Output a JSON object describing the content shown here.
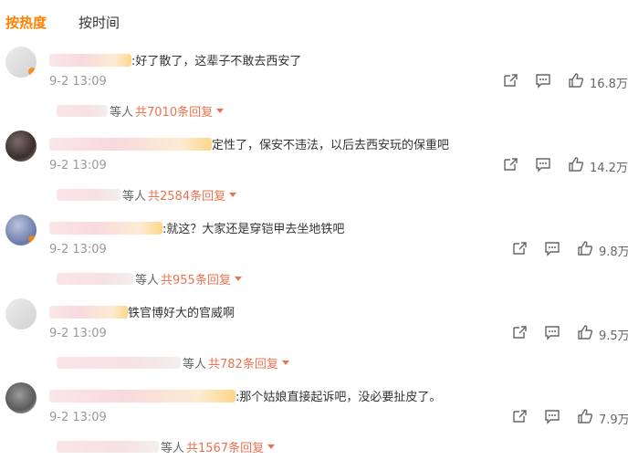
{
  "tabs": [
    {
      "label": "按热度",
      "active": true
    },
    {
      "label": "按时间",
      "active": false
    }
  ],
  "colors": {
    "accent": "#ff8200",
    "reply_link": "#eb7350",
    "muted": "#999999"
  },
  "comments": [
    {
      "text": ":好了散了，这辈子不敢去西安了",
      "time": "9-2 13:09",
      "likes": "16.8万",
      "reply_suffix": "等人",
      "reply_count": "共7010条回复"
    },
    {
      "text": "定性了，保安不违法，以后去西安玩的保重吧",
      "time": "9-2 13:09",
      "likes": "14.2万",
      "reply_suffix": "等人",
      "reply_count": "共2584条回复"
    },
    {
      "text": ":就这？大家还是穿铠甲去坐地铁吧",
      "time": "9-2 13:09",
      "likes": "9.8万",
      "reply_suffix": "等人",
      "reply_count": "共955条回复"
    },
    {
      "text": "铁官博好大的官威啊",
      "time": "9-2 13:09",
      "likes": "9.5万",
      "reply_suffix": "等人",
      "reply_count": "共782条回复"
    },
    {
      "text": ":那个姑娘直接起诉吧，没必要扯皮了。",
      "time": "9-2 13:09",
      "likes": "7.9万",
      "reply_suffix": "等人",
      "reply_count": "共1567条回复"
    }
  ],
  "icons": {
    "share": "share-icon",
    "comment": "comment-icon",
    "like": "thumbs-up-icon"
  }
}
